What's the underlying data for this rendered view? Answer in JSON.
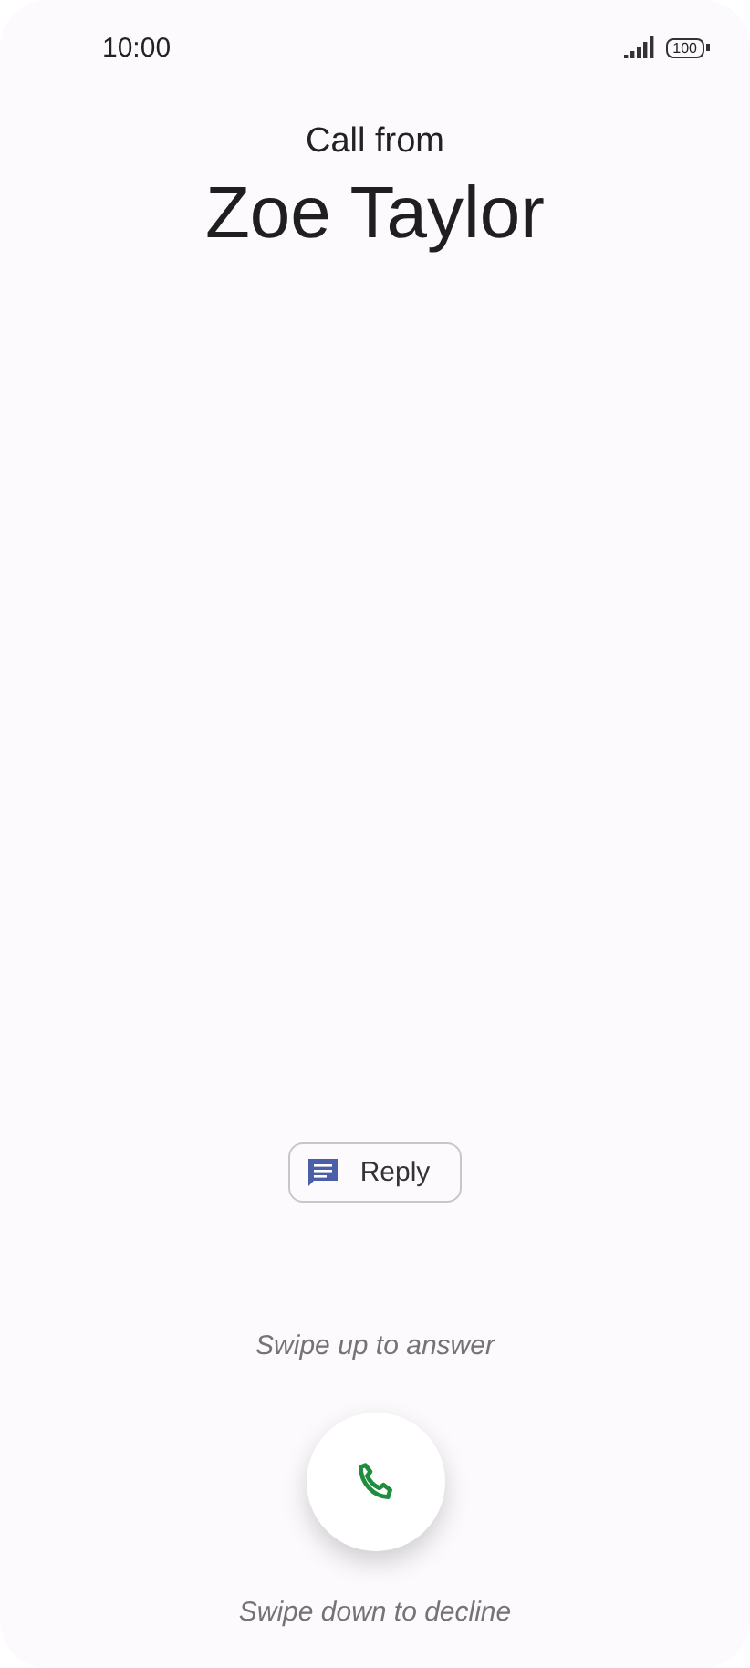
{
  "status_bar": {
    "time": "10:00",
    "battery": "100"
  },
  "caller": {
    "label": "Call from",
    "name": "Zoe Taylor"
  },
  "reply_button": {
    "label": "Reply"
  },
  "answer_hint": "Swipe up to answer",
  "decline_hint": "Swipe down to decline"
}
